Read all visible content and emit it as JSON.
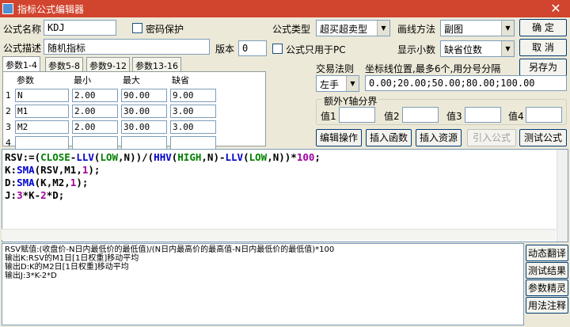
{
  "window": {
    "title": "指标公式编辑器",
    "close": "✕"
  },
  "form": {
    "name_label": "公式名称",
    "name_value": "KDJ",
    "password_label": "密码保护",
    "desc_label": "公式描述",
    "desc_value": "随机指标",
    "version_label": "版本",
    "version_value": "0",
    "type_label": "公式类型",
    "type_value": "超买超卖型",
    "draw_label": "画线方法",
    "draw_value": "副图",
    "pc_only_label": "公式只用于PC",
    "decimal_label": "显示小数",
    "decimal_value": "缺省位数",
    "trade_label": "交易法则",
    "trade_value": "左手",
    "coord_label": "坐标线位置,最多6个,用分号分隔",
    "coord_value": "0.00;20.00;50.00;80.00;100.00",
    "yaxis_label": "额外Y轴分界",
    "y1": "值1",
    "y2": "值2",
    "y3": "值3",
    "y4": "值4"
  },
  "buttons": {
    "ok": "确  定",
    "cancel": "取  消",
    "save_as": "另存为",
    "edit": "编辑操作",
    "insert_func": "插入函数",
    "insert_res": "插入资源",
    "import": "引入公式",
    "test": "测试公式",
    "dyn_translate": "动态翻译",
    "test_result": "测试结果",
    "param_wizard": "参数精灵",
    "usage_note": "用法注释"
  },
  "tabs": [
    "参数1-4",
    "参数5-8",
    "参数9-12",
    "参数13-16"
  ],
  "params": {
    "headers": [
      "参数",
      "最小",
      "最大",
      "缺省"
    ],
    "rows": [
      {
        "num": "1",
        "name": "N",
        "min": "2.00",
        "max": "90.00",
        "def": "9.00"
      },
      {
        "num": "2",
        "name": "M1",
        "min": "2.00",
        "max": "30.00",
        "def": "3.00"
      },
      {
        "num": "3",
        "name": "M2",
        "min": "2.00",
        "max": "30.00",
        "def": "3.00"
      },
      {
        "num": "4",
        "name": "",
        "min": "",
        "max": "",
        "def": ""
      }
    ]
  },
  "code": {
    "l1a": "RSV:=(",
    "l1b": "CLOSE",
    "l1c": "-",
    "l1d": "LLV",
    "l1e": "(",
    "l1f": "LOW",
    "l1g": ",N))/(",
    "l1h": "HHV",
    "l1i": "(",
    "l1j": "HIGH",
    "l1k": ",N)-",
    "l1l": "LLV",
    "l1m": "(",
    "l1n": "LOW",
    "l1o": ",N))*",
    "l1p": "100",
    "l1q": ";",
    "l2a": "K:",
    "l2b": "SMA",
    "l2c": "(RSV,M1,",
    "l2d": "1",
    "l2e": ");",
    "l3a": "D:",
    "l3b": "SMA",
    "l3c": "(K,M2,",
    "l3d": "1",
    "l3e": ");",
    "l4a": "J:",
    "l4b": "3",
    "l4c": "*K-",
    "l4d": "2",
    "l4e": "*D;"
  },
  "output": [
    "RSV赋值:(收盘价-N日内最低价的最低值)/(N日内最高价的最高值-N日内最低价的最低值)*100",
    "输出K:RSV的M1日[1日权重]移动平均",
    "输出D:K的M2日[1日权重]移动平均",
    "输出J:3*K-2*D"
  ]
}
